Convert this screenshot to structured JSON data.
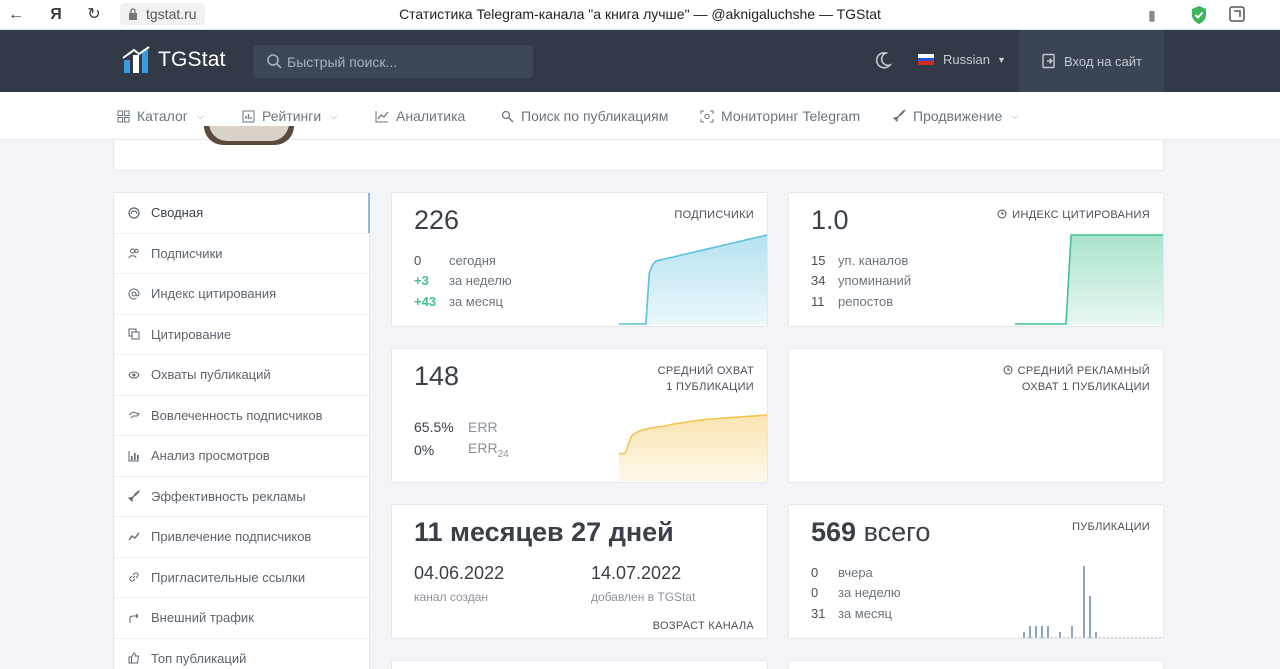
{
  "browser": {
    "url": "tgstat.ru",
    "tab_title": "Статистика Telegram-канала \"а книга лучше\" — @aknigaluchshe — TGStat"
  },
  "topnav": {
    "logo_text": "TGStat",
    "search_placeholder": "Быстрый поиск...",
    "language": "Russian",
    "login_label": "Вход на сайт"
  },
  "subnav": {
    "items": [
      {
        "label": "Каталог",
        "icon": "grid-icon",
        "has_dropdown": true
      },
      {
        "label": "Рейтинги",
        "icon": "bar-chart-icon",
        "has_dropdown": true
      },
      {
        "label": "Аналитика",
        "icon": "line-chart-icon",
        "has_dropdown": false
      },
      {
        "label": "Поиск по публикациям",
        "icon": "search-doc-icon",
        "has_dropdown": false
      },
      {
        "label": "Мониторинг Telegram",
        "icon": "monitor-icon",
        "has_dropdown": false
      },
      {
        "label": "Продвижение",
        "icon": "rocket-icon",
        "has_dropdown": true
      }
    ]
  },
  "sidebar": {
    "items": [
      {
        "label": "Сводная",
        "icon": "summary-icon",
        "active": true
      },
      {
        "label": "Подписчики",
        "icon": "users-icon"
      },
      {
        "label": "Индекс цитирования",
        "icon": "at-icon"
      },
      {
        "label": "Цитирование",
        "icon": "copy-icon"
      },
      {
        "label": "Охваты публикаций",
        "icon": "eye-icon"
      },
      {
        "label": "Вовлеченность подписчиков",
        "icon": "hand-icon"
      },
      {
        "label": "Анализ просмотров",
        "icon": "bars-icon"
      },
      {
        "label": "Эффективность рекламы",
        "icon": "rocket-icon"
      },
      {
        "label": "Привлечение подписчиков",
        "icon": "trend-icon"
      },
      {
        "label": "Пригласительные ссылки",
        "icon": "link-icon"
      },
      {
        "label": "Внешний трафик",
        "icon": "redirect-icon"
      },
      {
        "label": "Топ публикаций",
        "icon": "thumbs-up-icon"
      }
    ]
  },
  "cards": {
    "subscribers": {
      "value": "226",
      "label": "подписчики",
      "rows": [
        {
          "value": "0",
          "label": "сегодня"
        },
        {
          "value": "+3",
          "label": "за неделю"
        },
        {
          "value": "+43",
          "label": "за месяц"
        }
      ],
      "color": "#5bc0de"
    },
    "citation": {
      "value": "1.0",
      "label": "индекс цитирования",
      "rows": [
        {
          "value": "15",
          "label": "уп. каналов"
        },
        {
          "value": "34",
          "label": "упоминаний"
        },
        {
          "value": "11",
          "label": "репостов"
        }
      ],
      "color": "#41c28d"
    },
    "reach": {
      "value": "148",
      "label_line1": "средний охват",
      "label_line2": "1 публикации",
      "rows": [
        {
          "value": "65.5%",
          "label": "ERR",
          "sub": ""
        },
        {
          "value": "0%",
          "label": "ERR",
          "sub": "24"
        }
      ],
      "color": "#f5c451"
    },
    "ad_reach": {
      "label_line1": "средний рекламный",
      "label_line2": "охват 1 публикации"
    },
    "age": {
      "title": "11 месяцев 27 дней",
      "created_date": "04.06.2022",
      "created_label": "канал создан",
      "added_date": "14.07.2022",
      "added_label": "добавлен в TGStat",
      "label": "возраст канала"
    },
    "publications": {
      "total": "569",
      "total_suffix": "всего",
      "label": "публикации",
      "rows": [
        {
          "value": "0",
          "label": "вчера"
        },
        {
          "value": "0",
          "label": "за неделю"
        },
        {
          "value": "31",
          "label": "за месяц"
        }
      ]
    }
  },
  "chart_data": [
    {
      "type": "area",
      "series": [
        {
          "values": [
            0,
            0,
            0,
            0,
            0,
            0,
            0,
            0,
            0,
            130,
            150,
            160,
            162,
            164,
            166,
            168,
            170,
            172,
            174,
            176,
            178,
            180,
            182,
            184,
            186,
            188,
            190,
            192,
            194,
            196,
            198,
            200,
            202,
            204,
            206,
            208,
            210,
            212,
            214,
            216,
            218,
            220,
            222,
            224,
            226
          ]
        }
      ],
      "color": "#5bc0de"
    },
    {
      "type": "area",
      "series": [
        {
          "values": [
            0,
            0,
            0,
            0,
            0,
            0,
            0,
            0,
            0,
            0,
            0,
            1,
            1,
            1,
            1,
            1,
            1,
            1,
            1,
            1,
            1,
            1,
            1,
            1,
            1,
            1,
            1,
            1,
            1,
            1
          ]
        }
      ],
      "color": "#41c28d"
    },
    {
      "type": "area",
      "series": [
        {
          "values": [
            60,
            60,
            100,
            110,
            115,
            118,
            120,
            122,
            125,
            128,
            130,
            132,
            134,
            136,
            138,
            139,
            140,
            141,
            142,
            143,
            144,
            145,
            146,
            147,
            148
          ]
        }
      ],
      "color": "#f5c451"
    },
    {
      "type": "bar",
      "values": [
        1,
        2,
        2,
        2,
        2,
        0,
        1,
        0,
        2,
        0,
        12,
        7,
        1,
        0,
        0,
        0,
        0,
        0,
        0,
        0,
        0,
        0,
        0,
        0
      ],
      "color": "#8ca5c4"
    }
  ]
}
